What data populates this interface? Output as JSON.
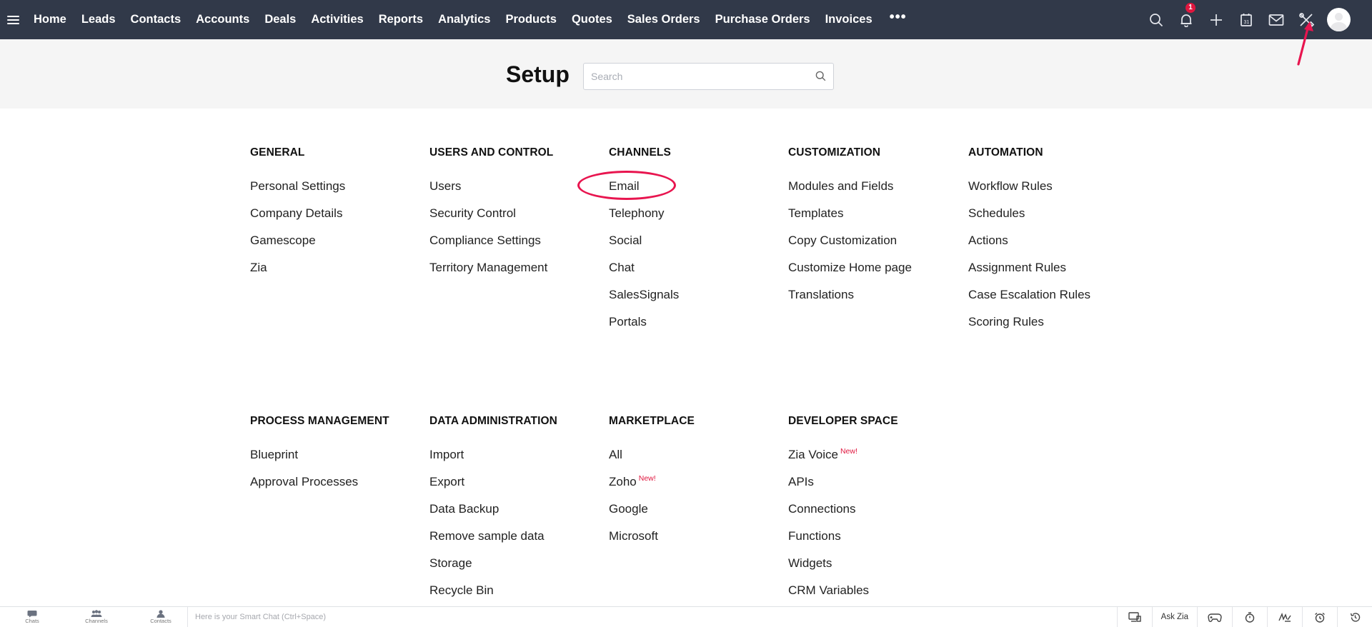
{
  "nav": {
    "links": [
      "Home",
      "Leads",
      "Contacts",
      "Accounts",
      "Deals",
      "Activities",
      "Reports",
      "Analytics",
      "Products",
      "Quotes",
      "Sales Orders",
      "Purchase Orders",
      "Invoices"
    ],
    "more": "•••",
    "notification_count": "1",
    "icons": [
      "search-icon",
      "bell-icon",
      "plus-icon",
      "calendar-icon",
      "mail-icon",
      "setup-tools-icon",
      "avatar"
    ]
  },
  "setup": {
    "title": "Setup",
    "search_placeholder": "Search"
  },
  "sections": [
    {
      "title": "GENERAL",
      "items": [
        {
          "label": "Personal Settings"
        },
        {
          "label": "Company Details"
        },
        {
          "label": "Gamescope"
        },
        {
          "label": "Zia"
        }
      ]
    },
    {
      "title": "USERS AND CONTROL",
      "items": [
        {
          "label": "Users"
        },
        {
          "label": "Security Control"
        },
        {
          "label": "Compliance Settings"
        },
        {
          "label": "Territory Management"
        }
      ]
    },
    {
      "title": "CHANNELS",
      "items": [
        {
          "label": "Email"
        },
        {
          "label": "Telephony"
        },
        {
          "label": "Social"
        },
        {
          "label": "Chat"
        },
        {
          "label": "SalesSignals"
        },
        {
          "label": "Portals"
        }
      ]
    },
    {
      "title": "CUSTOMIZATION",
      "items": [
        {
          "label": "Modules and Fields"
        },
        {
          "label": "Templates"
        },
        {
          "label": "Copy Customization"
        },
        {
          "label": "Customize Home page"
        },
        {
          "label": "Translations"
        }
      ]
    },
    {
      "title": "AUTOMATION",
      "items": [
        {
          "label": "Workflow Rules"
        },
        {
          "label": "Schedules"
        },
        {
          "label": "Actions"
        },
        {
          "label": "Assignment Rules"
        },
        {
          "label": "Case Escalation Rules"
        },
        {
          "label": "Scoring Rules"
        }
      ]
    },
    {
      "title": "PROCESS MANAGEMENT",
      "items": [
        {
          "label": "Blueprint"
        },
        {
          "label": "Approval Processes"
        }
      ]
    },
    {
      "title": "DATA ADMINISTRATION",
      "items": [
        {
          "label": "Import"
        },
        {
          "label": "Export"
        },
        {
          "label": "Data Backup"
        },
        {
          "label": "Remove sample data"
        },
        {
          "label": "Storage"
        },
        {
          "label": "Recycle Bin"
        }
      ]
    },
    {
      "title": "MARKETPLACE",
      "items": [
        {
          "label": "All"
        },
        {
          "label": "Zoho",
          "badge": "New!"
        },
        {
          "label": "Google"
        },
        {
          "label": "Microsoft"
        }
      ]
    },
    {
      "title": "DEVELOPER SPACE",
      "items": [
        {
          "label": "Zia Voice",
          "badge": "New!"
        },
        {
          "label": "APIs"
        },
        {
          "label": "Connections"
        },
        {
          "label": "Functions"
        },
        {
          "label": "Widgets"
        },
        {
          "label": "CRM Variables"
        }
      ]
    }
  ],
  "bottom": {
    "tabs": [
      "Chats",
      "Channels",
      "Contacts"
    ],
    "smartchat_placeholder": "Here is your Smart Chat (Ctrl+Space)",
    "ask_zia": "Ask Zia"
  },
  "colors": {
    "nav_bg": "#313949",
    "annotation": "#e8154f",
    "badge": "#e0173f"
  }
}
